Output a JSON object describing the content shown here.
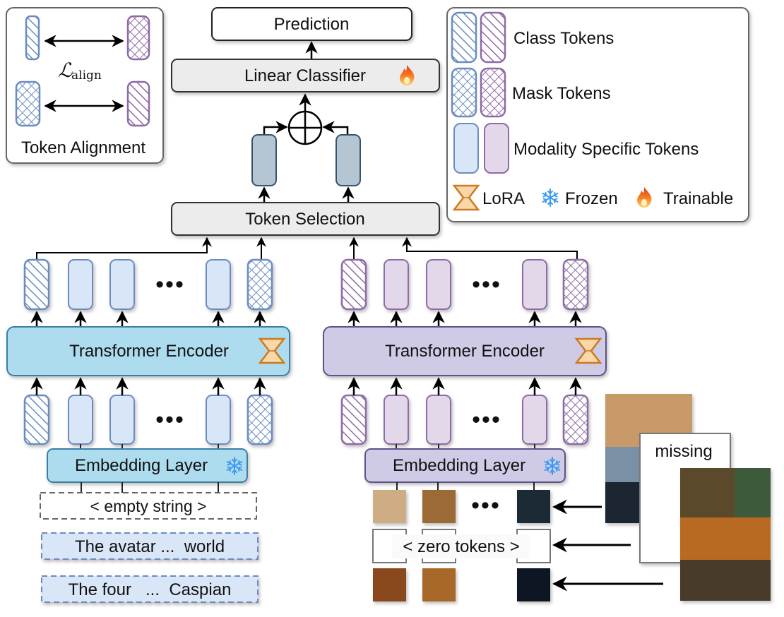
{
  "colors": {
    "text_blue": "#6a8cc0",
    "text_fill": "#d8e6f8",
    "image_purple": "#8e6aa6",
    "image_fill": "#e2d8ea",
    "encoder_text_fill": "#aedcef",
    "encoder_text_stroke": "#3a7fa8",
    "encoder_image_fill": "#cfcbe6",
    "encoder_image_stroke": "#5a5488",
    "gray_box": "#ececec",
    "selected_token": "#b6c5d2",
    "lora_fill": "#f8d7a8",
    "lora_stroke": "#cd7a22",
    "snowflake": "#3d9af0",
    "flame": "#f05a1a"
  },
  "legend_alignment": {
    "loss_symbol": "ℒ",
    "loss_subscript": "align",
    "title": "Token Alignment"
  },
  "legend_tokens": {
    "class_tokens": "Class Tokens",
    "mask_tokens": "Mask Tokens",
    "modality_tokens": "Modality Specific Tokens",
    "lora": "LoRA",
    "frozen": "Frozen",
    "trainable": "Trainable"
  },
  "head": {
    "prediction": "Prediction",
    "linear_classifier": "Linear Classifier",
    "token_selection": "Token Selection"
  },
  "text_branch": {
    "encoder": "Transformer Encoder",
    "embedding": "Embedding Layer",
    "inputs": [
      "< empty string >",
      "The avatar ...  world",
      "The four   ...  Caspian"
    ]
  },
  "image_branch": {
    "encoder": "Transformer Encoder",
    "embedding": "Embedding Layer",
    "zero_tokens": "< zero tokens >",
    "missing_label": "missing"
  },
  "ellipsis": "•••"
}
